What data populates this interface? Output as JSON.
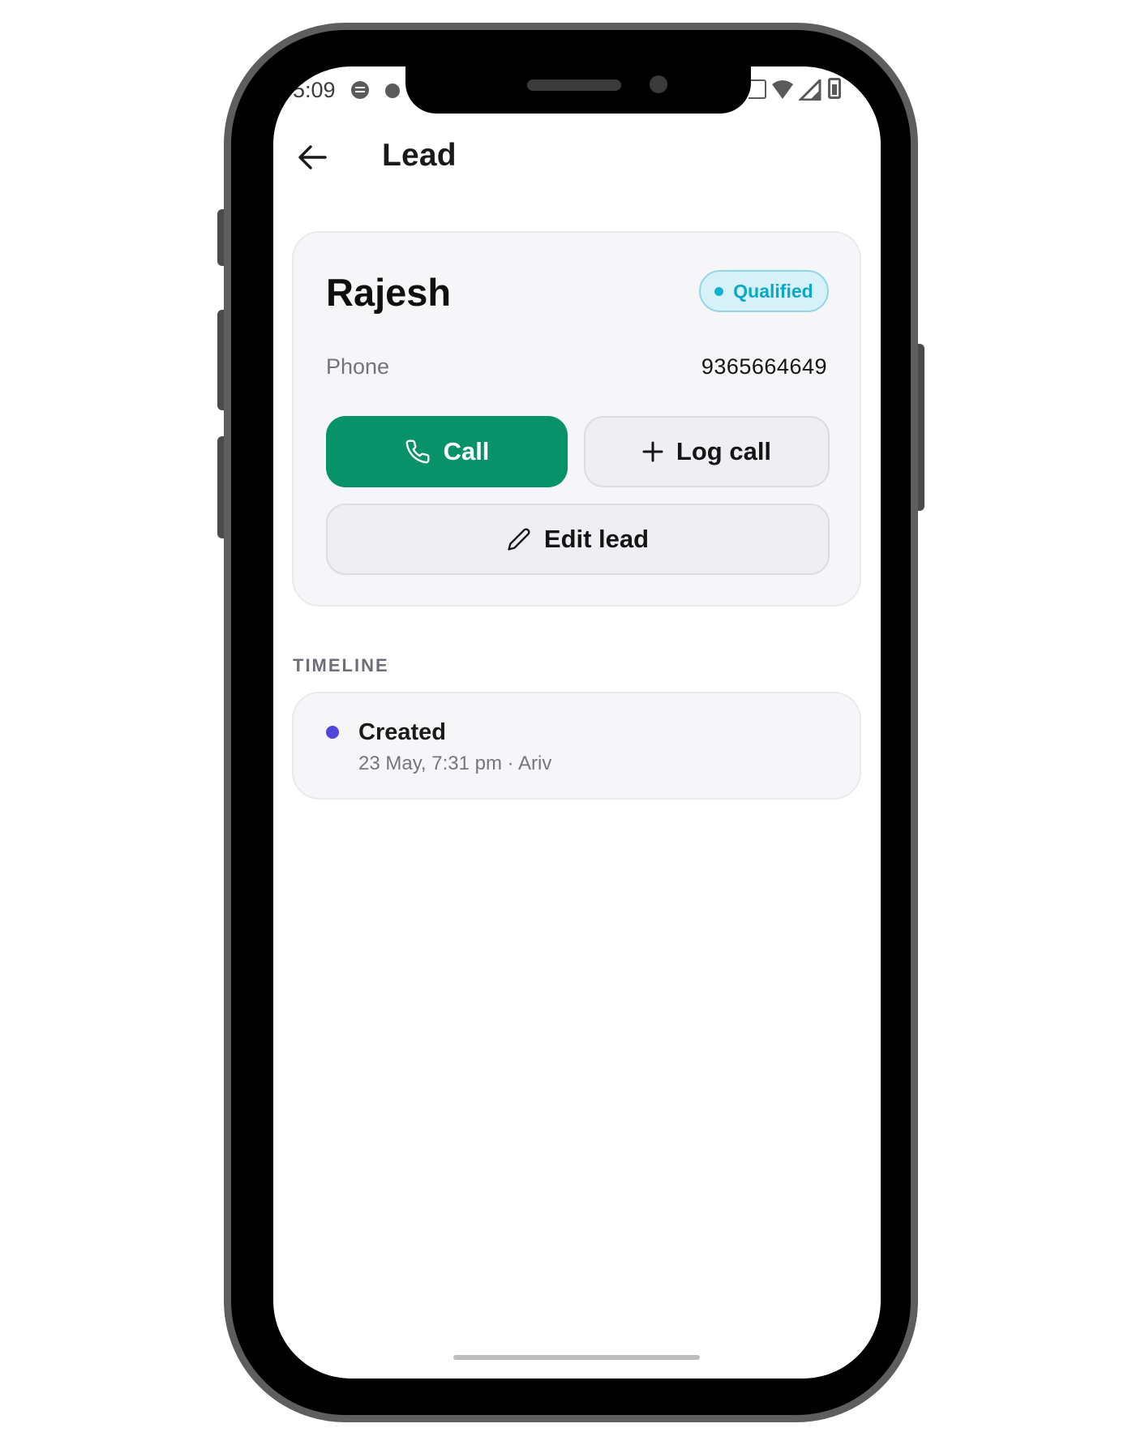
{
  "status_bar": {
    "time": "5:09",
    "icons": [
      "message-icon",
      "notification-dot-icon",
      "wifi-calling-icon",
      "wifi-icon",
      "signal-icon",
      "battery-icon"
    ]
  },
  "app_bar": {
    "title": "Lead",
    "back_icon": "arrow-left-icon"
  },
  "lead": {
    "name": "Rajesh",
    "status": "Qualified",
    "phone_label": "Phone",
    "phone_value": "9365664649"
  },
  "actions": {
    "call_label": "Call",
    "call_icon": "phone-icon",
    "log_call_label": "Log call",
    "log_call_icon": "plus-icon",
    "edit_label": "Edit lead",
    "edit_icon": "pencil-icon"
  },
  "timeline": {
    "heading": "TIMELINE",
    "events": [
      {
        "title": "Created",
        "meta": "23 May, 7:31 pm · Ariv"
      }
    ]
  },
  "colors": {
    "primary": "#07926a",
    "badge_text": "#0ba7c7",
    "badge_bg": "#d7f1f8",
    "timeline_dot": "#5045dd",
    "card_bg": "#f6f6f9"
  }
}
